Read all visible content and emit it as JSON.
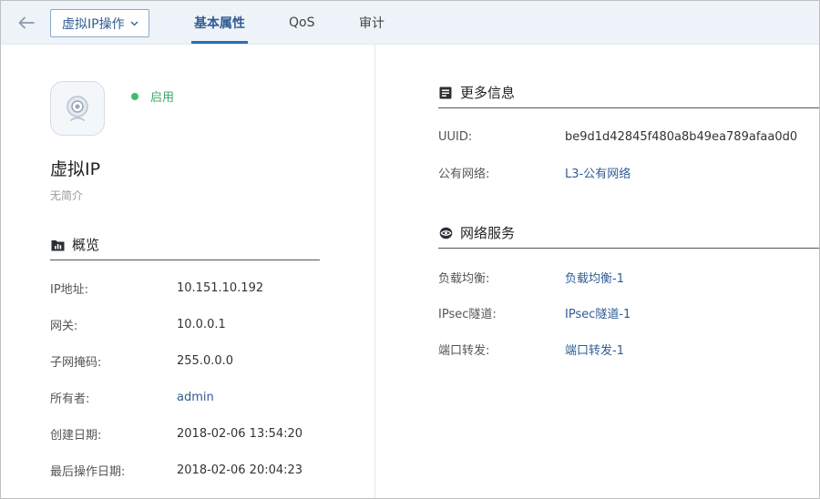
{
  "header": {
    "action_dropdown_label": "虚拟IP操作",
    "tabs": [
      {
        "label": "基本属性",
        "active": true
      },
      {
        "label": "QoS",
        "active": false
      },
      {
        "label": "审计",
        "active": false
      }
    ]
  },
  "resource": {
    "status": "启用",
    "name": "虚拟IP",
    "description": "无简介"
  },
  "overview": {
    "title": "概览",
    "rows": [
      {
        "label": "IP地址:",
        "value": "10.151.10.192"
      },
      {
        "label": "网关:",
        "value": "10.0.0.1"
      },
      {
        "label": "子网掩码:",
        "value": "255.0.0.0"
      },
      {
        "label": "所有者:",
        "value": "admin"
      },
      {
        "label": "创建日期:",
        "value": "2018-02-06 13:54:20"
      },
      {
        "label": "最后操作日期:",
        "value": "2018-02-06 20:04:23"
      }
    ]
  },
  "more_info": {
    "title": "更多信息",
    "rows": [
      {
        "label": "UUID:",
        "value": "be9d1d42845f480a8b49ea789afaa0d0"
      },
      {
        "label": "公有网络:",
        "value": "L3-公有网络"
      }
    ]
  },
  "network_services": {
    "title": "网络服务",
    "rows": [
      {
        "label": "负载均衡:",
        "value": "负载均衡-1"
      },
      {
        "label": "IPsec隧道:",
        "value": "IPsec隧道-1"
      },
      {
        "label": "端口转发:",
        "value": "端口转发-1"
      }
    ]
  },
  "colors": {
    "accent": "#2f5c93",
    "status_green": "#3ebd6e",
    "header_bg": "#eef3f9"
  },
  "icons": {
    "back": "arrow-left-icon",
    "dropdown": "chevron-down-icon",
    "avatar": "camera-icon",
    "overview": "chart-folder-icon",
    "more_info": "info-card-icon",
    "network_services": "network-icon"
  }
}
